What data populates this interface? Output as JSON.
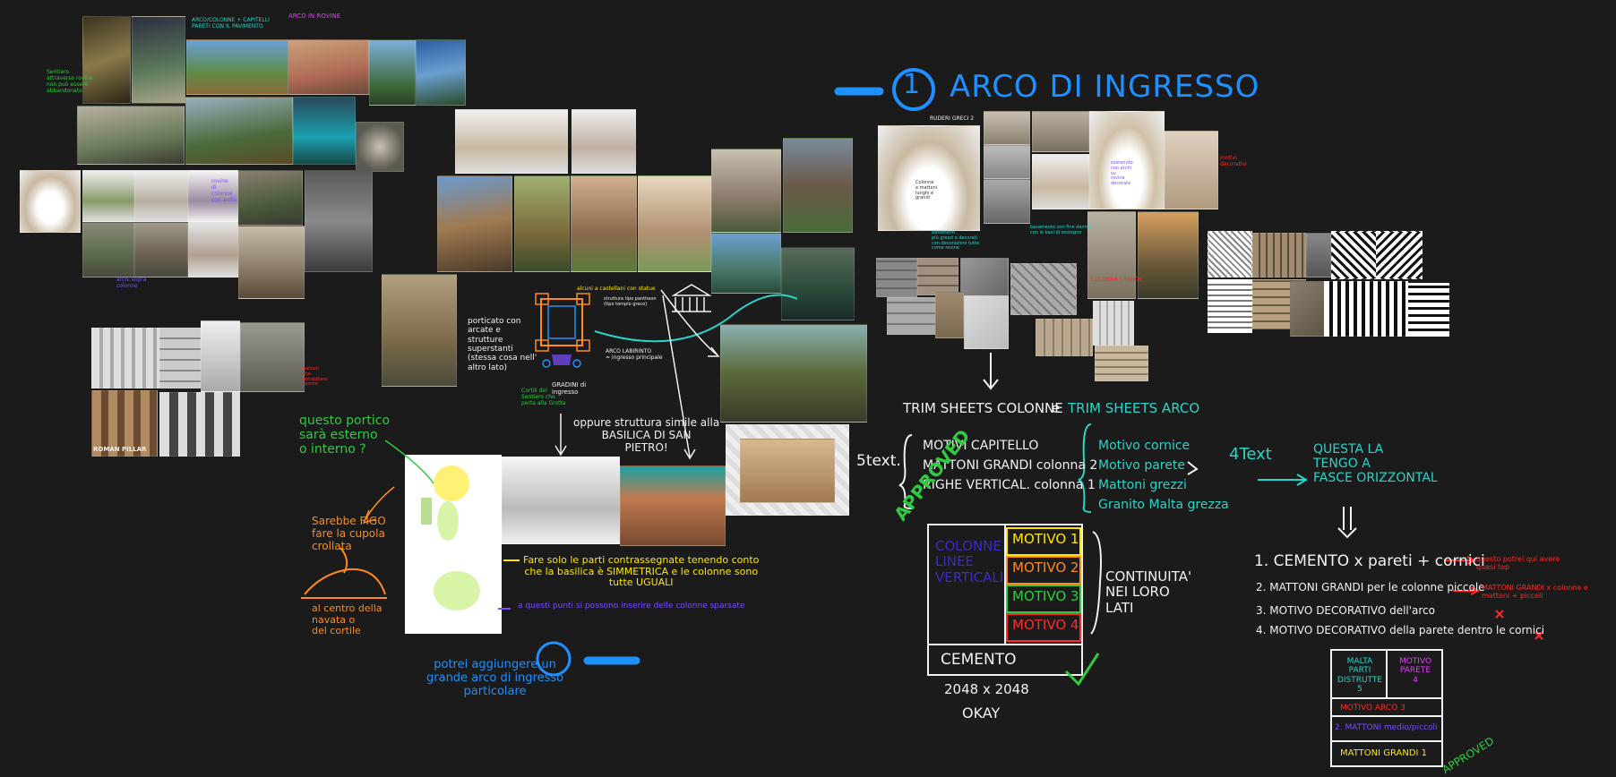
{
  "colors": {
    "background": "#1b1b1b",
    "white": "#f2f2f2",
    "blue": "#1e90ff",
    "cyan": "#2ad4c8",
    "green": "#2ecc40",
    "yellow": "#ffe600",
    "orange": "#ff8a1e",
    "red": "#ff2a2a",
    "magenta": "#e040fb",
    "purple": "#7b4dff",
    "lime": "#7dff2a"
  },
  "section": {
    "number": "1",
    "title": "ARCO DI INGRESSO"
  },
  "trim": {
    "heading_columns": "TRIM SHEETS COLONNE",
    "heading_and": "e",
    "heading_arch": "TRIM SHEETS ARCO",
    "count_left": "5text.",
    "count_right": "4Text",
    "left_items": [
      "MOTIVI CAPITELLO",
      "MATTONI GRANDI colonna 2",
      "RIGHE VERTICAL. colonna 1"
    ],
    "right_items": [
      "Motivo cornice",
      "Motivo parete",
      "Mattoni grezzi",
      "Granito Malta grezza"
    ],
    "horizontal_note": "QUESTA LA\nTENGO A\nFASCE ORIZZONTAL"
  },
  "grid_box": {
    "stamp": "APPROVED",
    "left_label": "COLONNE\nLINEE\nVERTICALI",
    "motifs": [
      "MOTIVO 1",
      "MOTIVO 2",
      "MOTIVO 3",
      "MOTIVO 4"
    ],
    "bottom": "CEMENTO",
    "side_note": "CONTINUITA'\nNEI LORO\nLATI",
    "size": "2048 x 2048",
    "ok": "OKAY"
  },
  "list": {
    "items": [
      "1. CEMENTO x pareti + cornici",
      "2. MATTONI GRANDI per le colonne piccole",
      "3. MOTIVO DECORATIVO dell'arco",
      "4. MOTIVO DECORATIVO della parete dentro le cornici"
    ],
    "notes": [
      "questo potrei qui avere\nquasi top",
      "MATTONI GRANDI x colonne e\nmattoni + piccoli"
    ],
    "cross": "x"
  },
  "small_grid": {
    "cells": [
      "MALTA\nPARTI DISTRUTTE\n5",
      "MOTIVO\nPARETE\n4",
      "MOTIVO ARCO 3",
      "2. MATTONI medio/piccoli",
      "MATTONI GRANDI 1"
    ],
    "stamp": "APPROVED"
  },
  "diagram_notes": {
    "portico": "porticato con\narcate e\nstrutture\nsuperstanti\n(stessa cosa nell'\naltro lato)",
    "castle": "alcuni a castellani con statue",
    "tiny1": "struttura tipo pantheon\n(tipo tempio greco)",
    "entrance": "ARCO LABIRINTO\n= ingresso principale",
    "stairs": "GRADINI di\ningresso",
    "cortile": "Cortili del\nSentiero che\nporta alla Grotta",
    "basilica": "oppure struttura simile alla\nBASILICA DI SAN\nPIETRO!",
    "external": "questo portico\nsarà esterno\no interno ?",
    "dome": "Sarebbe FIGO\nfare la cupola\ncrollata",
    "center": "al centro della\nnavata o\ndel cortile",
    "symmetry": "Fare solo le parti contrassegnate tenendo conto\nche la basilica è SIMMETRICA e le colonne sono\ntutte UGUALI",
    "columns_note": "a questi punti si possono inserire delle colonne sparsate",
    "big_arch": "potrei aggiungere un\ngrande arco di ingresso\nparticolare"
  },
  "moodboard_notes": {
    "green_left": "Sentiero\nattraverso rovine\nnon può essere\nabbandonato",
    "cyan_top": "ARCO/COLONNE + CAPITELLI\nPARETI CON IL PAVIMENTO",
    "magenta_top": "ARCO IN ROVINE",
    "purple_mid": "rovine\ndi\ncolonne\ncon archi",
    "red_small": "balconi\nche\npotrebbero\nservire",
    "purple_small": "archi sopra\ncolonne",
    "pillar_caption": "ROMAN PILLAR"
  },
  "arch_notes": {
    "top": "RUDERI GRECI 2",
    "left": "Colonne\ne mattoni\nlunghi e\ngrandi",
    "mid": "sostenuto\ncon archi\nsu\nrovine\ndecorate",
    "cyan_mid": "basamento con fine dentro\ncon le basi di sostegno",
    "cyan_left": "basamenti\npiù grezzi e decorati\ncon decorazioni tutte\ncome rovine ",
    "red_right": "motivi\ndecorativi",
    "red_mid": "COLONNA GRANDE"
  }
}
